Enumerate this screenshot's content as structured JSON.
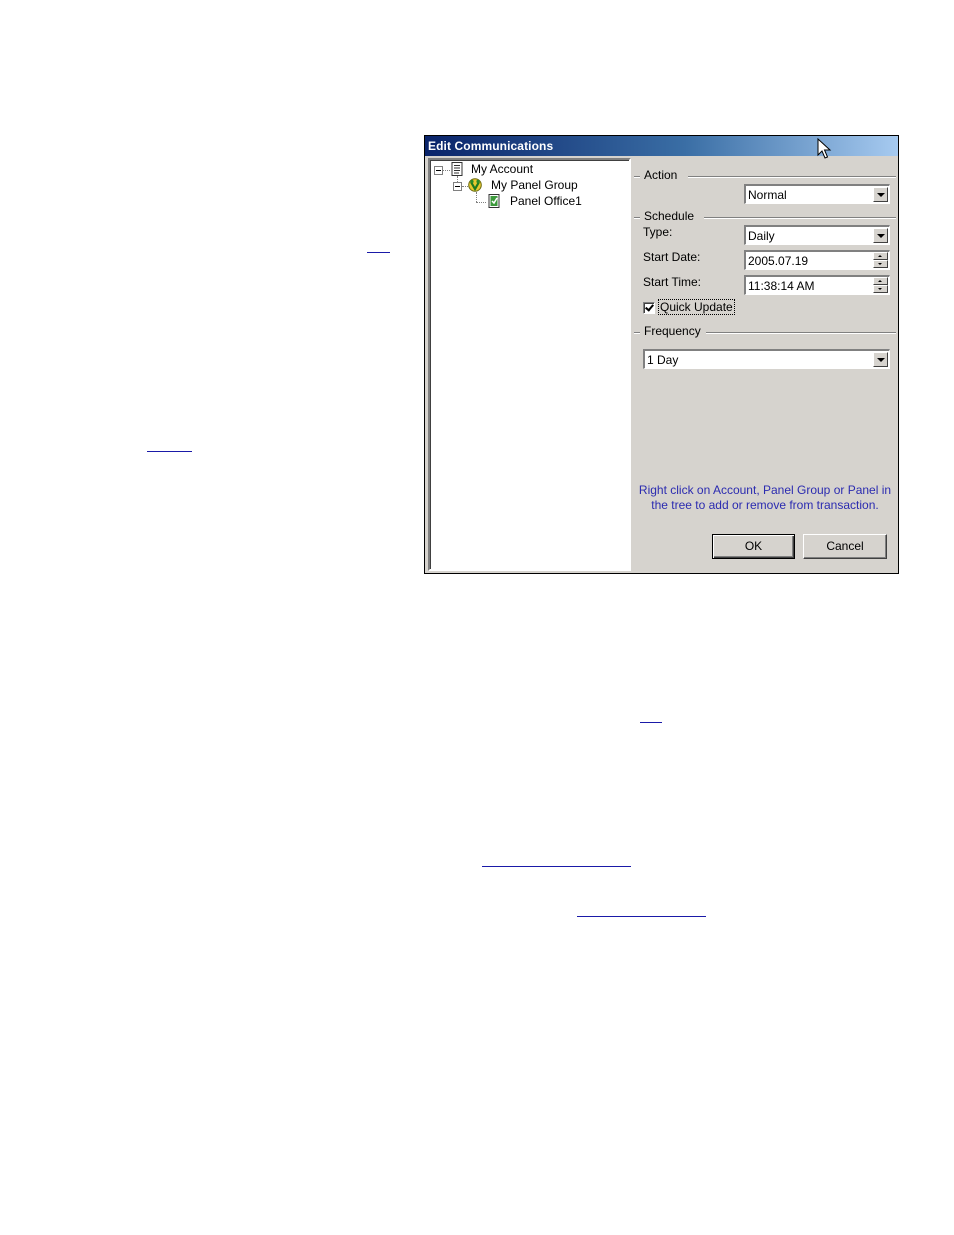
{
  "dialog": {
    "title": "Edit Communications"
  },
  "tree": {
    "items": [
      {
        "label": "My Account",
        "icon": "document-icon"
      },
      {
        "label": "My Panel Group",
        "icon": "panel-group-icon"
      },
      {
        "label": "Panel Office1",
        "icon": "panel-icon"
      }
    ]
  },
  "action": {
    "group_label": "Action",
    "value": "Normal"
  },
  "schedule": {
    "group_label": "Schedule",
    "type_label": "Type:",
    "type_value": "Daily",
    "start_date_label": "Start Date:",
    "start_date_value": "2005.07.19",
    "start_time_label": "Start Time:",
    "start_time_value": "11:38:14 AM",
    "quick_update_label": "Quick Update",
    "quick_update_checked": true
  },
  "frequency": {
    "group_label": "Frequency",
    "value": "1 Day"
  },
  "hint": {
    "line1": "Right click on Account, Panel Group or Panel in",
    "line2": "the tree to add or remove from transaction."
  },
  "buttons": {
    "ok": "OK",
    "cancel": "Cancel"
  },
  "colors": {
    "titlebar_start": "#0a246a",
    "titlebar_end": "#a6caf0",
    "dialog_face": "#d6d3ce",
    "hint_text": "#2b2bb0",
    "link_underline": "#1a1aa8"
  }
}
